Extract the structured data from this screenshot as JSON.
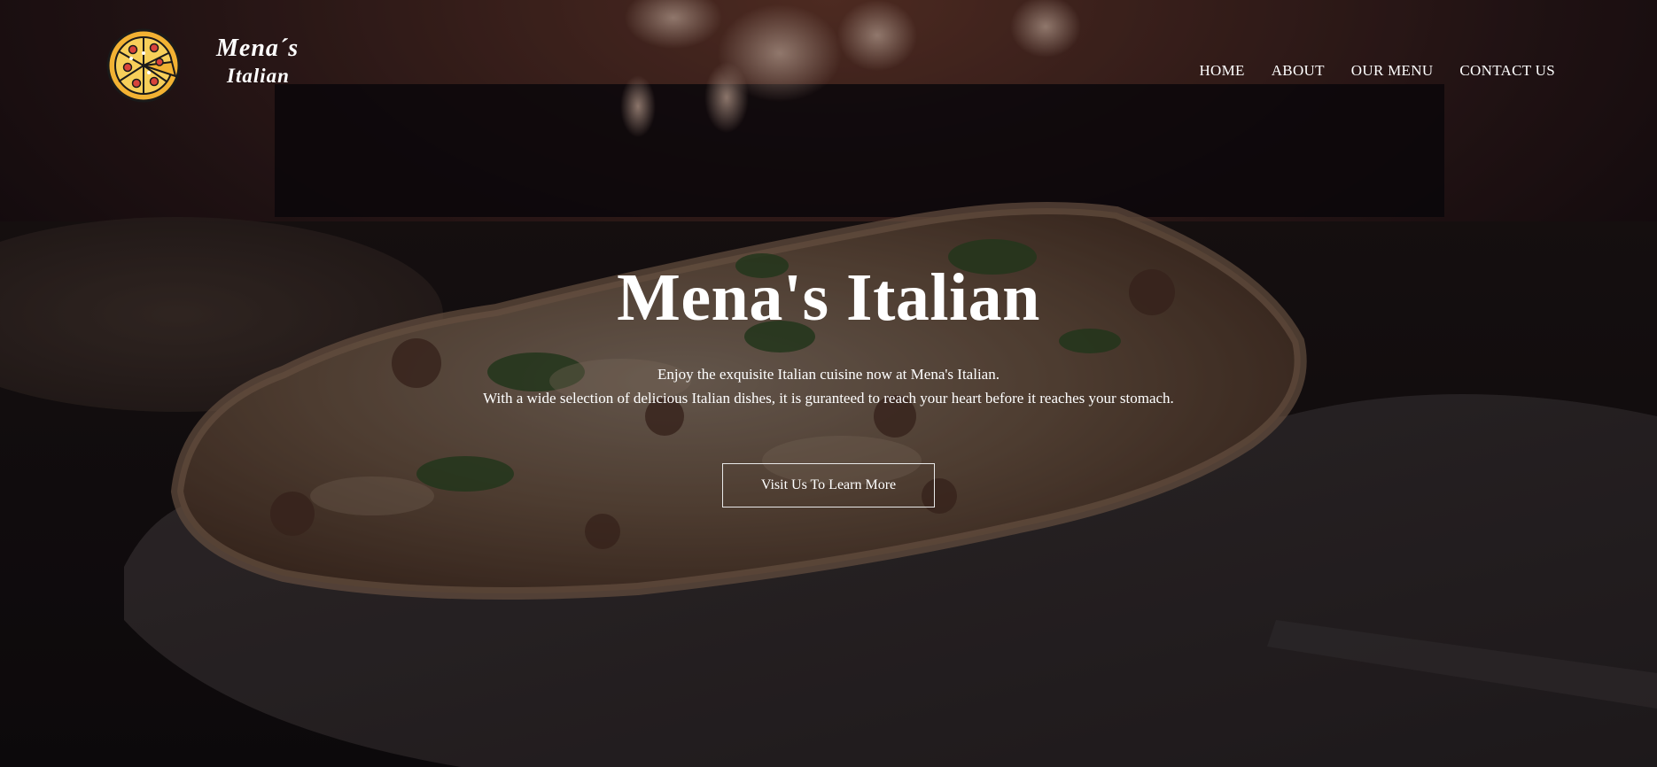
{
  "brand": {
    "name_line1": "Mena´s",
    "name_line2": "Italian",
    "logo_icon": "pizza-icon"
  },
  "nav": {
    "items": [
      {
        "label": "HOME"
      },
      {
        "label": "ABOUT"
      },
      {
        "label": "OUR MENU"
      },
      {
        "label": "CONTACT US"
      }
    ]
  },
  "hero": {
    "title": "Mena's Italian",
    "line1": "Enjoy the exquisite Italian cuisine now at Mena's Italian.",
    "line2": "With a wide selection of delicious Italian dishes, it is guranteed to reach your heart before it reaches your stomach.",
    "cta_label": "Visit Us To Learn More"
  },
  "colors": {
    "text": "#ffffff",
    "overlay": "#0a080e",
    "logo_crust": "#f2b233",
    "logo_pepperoni": "#d9433b",
    "logo_outline": "#1a1a1a"
  }
}
